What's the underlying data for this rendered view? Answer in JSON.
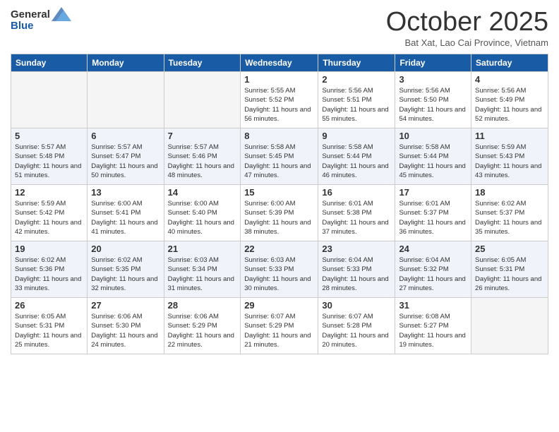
{
  "header": {
    "logo_general": "General",
    "logo_blue": "Blue",
    "month": "October 2025",
    "location": "Bat Xat, Lao Cai Province, Vietnam"
  },
  "weekdays": [
    "Sunday",
    "Monday",
    "Tuesday",
    "Wednesday",
    "Thursday",
    "Friday",
    "Saturday"
  ],
  "weeks": [
    [
      {
        "day": "",
        "info": ""
      },
      {
        "day": "",
        "info": ""
      },
      {
        "day": "",
        "info": ""
      },
      {
        "day": "1",
        "info": "Sunrise: 5:55 AM\nSunset: 5:52 PM\nDaylight: 11 hours and 56 minutes."
      },
      {
        "day": "2",
        "info": "Sunrise: 5:56 AM\nSunset: 5:51 PM\nDaylight: 11 hours and 55 minutes."
      },
      {
        "day": "3",
        "info": "Sunrise: 5:56 AM\nSunset: 5:50 PM\nDaylight: 11 hours and 54 minutes."
      },
      {
        "day": "4",
        "info": "Sunrise: 5:56 AM\nSunset: 5:49 PM\nDaylight: 11 hours and 52 minutes."
      }
    ],
    [
      {
        "day": "5",
        "info": "Sunrise: 5:57 AM\nSunset: 5:48 PM\nDaylight: 11 hours and 51 minutes."
      },
      {
        "day": "6",
        "info": "Sunrise: 5:57 AM\nSunset: 5:47 PM\nDaylight: 11 hours and 50 minutes."
      },
      {
        "day": "7",
        "info": "Sunrise: 5:57 AM\nSunset: 5:46 PM\nDaylight: 11 hours and 48 minutes."
      },
      {
        "day": "8",
        "info": "Sunrise: 5:58 AM\nSunset: 5:45 PM\nDaylight: 11 hours and 47 minutes."
      },
      {
        "day": "9",
        "info": "Sunrise: 5:58 AM\nSunset: 5:44 PM\nDaylight: 11 hours and 46 minutes."
      },
      {
        "day": "10",
        "info": "Sunrise: 5:58 AM\nSunset: 5:44 PM\nDaylight: 11 hours and 45 minutes."
      },
      {
        "day": "11",
        "info": "Sunrise: 5:59 AM\nSunset: 5:43 PM\nDaylight: 11 hours and 43 minutes."
      }
    ],
    [
      {
        "day": "12",
        "info": "Sunrise: 5:59 AM\nSunset: 5:42 PM\nDaylight: 11 hours and 42 minutes."
      },
      {
        "day": "13",
        "info": "Sunrise: 6:00 AM\nSunset: 5:41 PM\nDaylight: 11 hours and 41 minutes."
      },
      {
        "day": "14",
        "info": "Sunrise: 6:00 AM\nSunset: 5:40 PM\nDaylight: 11 hours and 40 minutes."
      },
      {
        "day": "15",
        "info": "Sunrise: 6:00 AM\nSunset: 5:39 PM\nDaylight: 11 hours and 38 minutes."
      },
      {
        "day": "16",
        "info": "Sunrise: 6:01 AM\nSunset: 5:38 PM\nDaylight: 11 hours and 37 minutes."
      },
      {
        "day": "17",
        "info": "Sunrise: 6:01 AM\nSunset: 5:37 PM\nDaylight: 11 hours and 36 minutes."
      },
      {
        "day": "18",
        "info": "Sunrise: 6:02 AM\nSunset: 5:37 PM\nDaylight: 11 hours and 35 minutes."
      }
    ],
    [
      {
        "day": "19",
        "info": "Sunrise: 6:02 AM\nSunset: 5:36 PM\nDaylight: 11 hours and 33 minutes."
      },
      {
        "day": "20",
        "info": "Sunrise: 6:02 AM\nSunset: 5:35 PM\nDaylight: 11 hours and 32 minutes."
      },
      {
        "day": "21",
        "info": "Sunrise: 6:03 AM\nSunset: 5:34 PM\nDaylight: 11 hours and 31 minutes."
      },
      {
        "day": "22",
        "info": "Sunrise: 6:03 AM\nSunset: 5:33 PM\nDaylight: 11 hours and 30 minutes."
      },
      {
        "day": "23",
        "info": "Sunrise: 6:04 AM\nSunset: 5:33 PM\nDaylight: 11 hours and 28 minutes."
      },
      {
        "day": "24",
        "info": "Sunrise: 6:04 AM\nSunset: 5:32 PM\nDaylight: 11 hours and 27 minutes."
      },
      {
        "day": "25",
        "info": "Sunrise: 6:05 AM\nSunset: 5:31 PM\nDaylight: 11 hours and 26 minutes."
      }
    ],
    [
      {
        "day": "26",
        "info": "Sunrise: 6:05 AM\nSunset: 5:31 PM\nDaylight: 11 hours and 25 minutes."
      },
      {
        "day": "27",
        "info": "Sunrise: 6:06 AM\nSunset: 5:30 PM\nDaylight: 11 hours and 24 minutes."
      },
      {
        "day": "28",
        "info": "Sunrise: 6:06 AM\nSunset: 5:29 PM\nDaylight: 11 hours and 22 minutes."
      },
      {
        "day": "29",
        "info": "Sunrise: 6:07 AM\nSunset: 5:29 PM\nDaylight: 11 hours and 21 minutes."
      },
      {
        "day": "30",
        "info": "Sunrise: 6:07 AM\nSunset: 5:28 PM\nDaylight: 11 hours and 20 minutes."
      },
      {
        "day": "31",
        "info": "Sunrise: 6:08 AM\nSunset: 5:27 PM\nDaylight: 11 hours and 19 minutes."
      },
      {
        "day": "",
        "info": ""
      }
    ]
  ]
}
